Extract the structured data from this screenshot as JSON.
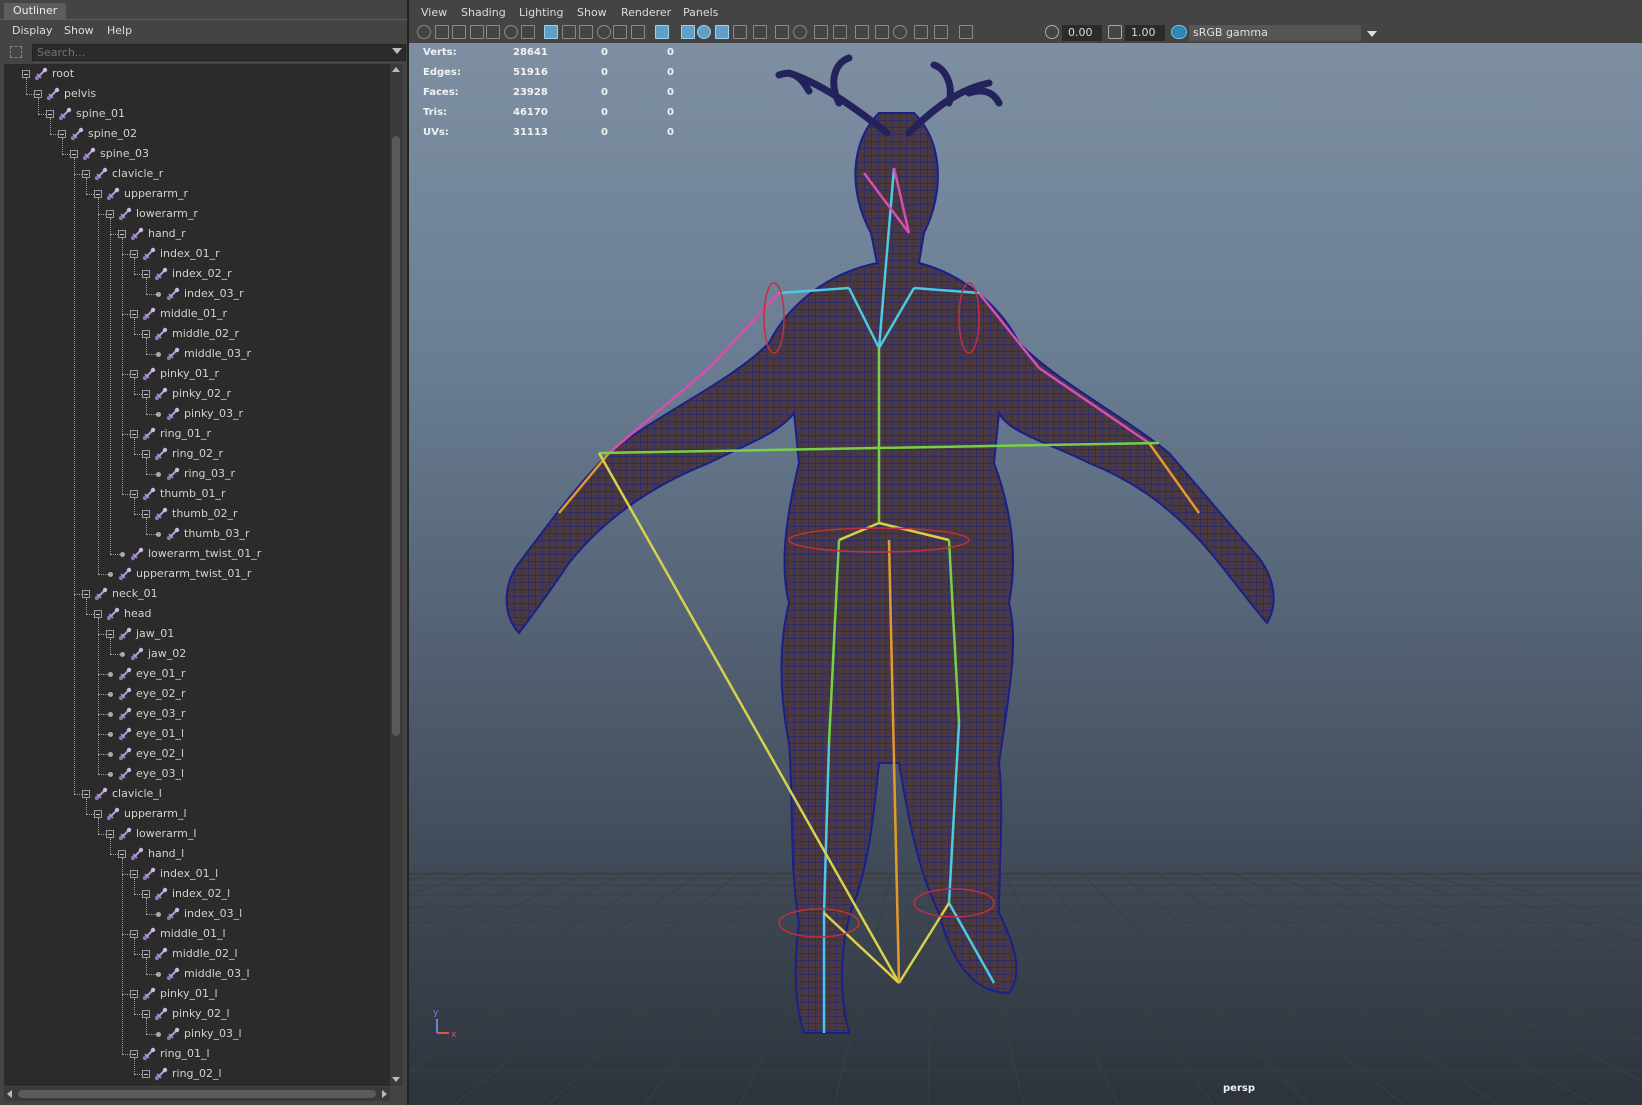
{
  "outliner": {
    "tab_title": "Outliner",
    "menu": [
      "Display",
      "Show",
      "Help"
    ],
    "search_placeholder": "Search...",
    "tree": [
      {
        "label": "root",
        "depth": 0,
        "expanded": true
      },
      {
        "label": "pelvis",
        "depth": 1,
        "expanded": true
      },
      {
        "label": "spine_01",
        "depth": 2,
        "expanded": true
      },
      {
        "label": "spine_02",
        "depth": 3,
        "expanded": true
      },
      {
        "label": "spine_03",
        "depth": 4,
        "expanded": true
      },
      {
        "label": "clavicle_r",
        "depth": 5,
        "expanded": true
      },
      {
        "label": "upperarm_r",
        "depth": 6,
        "expanded": true
      },
      {
        "label": "lowerarm_r",
        "depth": 7,
        "expanded": true
      },
      {
        "label": "hand_r",
        "depth": 8,
        "expanded": true
      },
      {
        "label": "index_01_r",
        "depth": 9,
        "expanded": true
      },
      {
        "label": "index_02_r",
        "depth": 10,
        "expanded": true
      },
      {
        "label": "index_03_r",
        "depth": 11,
        "expanded": false
      },
      {
        "label": "middle_01_r",
        "depth": 9,
        "expanded": true
      },
      {
        "label": "middle_02_r",
        "depth": 10,
        "expanded": true
      },
      {
        "label": "middle_03_r",
        "depth": 11,
        "expanded": false
      },
      {
        "label": "pinky_01_r",
        "depth": 9,
        "expanded": true
      },
      {
        "label": "pinky_02_r",
        "depth": 10,
        "expanded": true
      },
      {
        "label": "pinky_03_r",
        "depth": 11,
        "expanded": false
      },
      {
        "label": "ring_01_r",
        "depth": 9,
        "expanded": true
      },
      {
        "label": "ring_02_r",
        "depth": 10,
        "expanded": true
      },
      {
        "label": "ring_03_r",
        "depth": 11,
        "expanded": false
      },
      {
        "label": "thumb_01_r",
        "depth": 9,
        "expanded": true
      },
      {
        "label": "thumb_02_r",
        "depth": 10,
        "expanded": true
      },
      {
        "label": "thumb_03_r",
        "depth": 11,
        "expanded": false
      },
      {
        "label": "lowerarm_twist_01_r",
        "depth": 8,
        "expanded": false
      },
      {
        "label": "upperarm_twist_01_r",
        "depth": 7,
        "expanded": false
      },
      {
        "label": "neck_01",
        "depth": 5,
        "expanded": true
      },
      {
        "label": "head",
        "depth": 6,
        "expanded": true
      },
      {
        "label": "jaw_01",
        "depth": 7,
        "expanded": true
      },
      {
        "label": "jaw_02",
        "depth": 8,
        "expanded": false
      },
      {
        "label": "eye_01_r",
        "depth": 7,
        "expanded": false
      },
      {
        "label": "eye_02_r",
        "depth": 7,
        "expanded": false
      },
      {
        "label": "eye_03_r",
        "depth": 7,
        "expanded": false
      },
      {
        "label": "eye_01_l",
        "depth": 7,
        "expanded": false
      },
      {
        "label": "eye_02_l",
        "depth": 7,
        "expanded": false
      },
      {
        "label": "eye_03_l",
        "depth": 7,
        "expanded": false
      },
      {
        "label": "clavicle_l",
        "depth": 5,
        "expanded": true
      },
      {
        "label": "upperarm_l",
        "depth": 6,
        "expanded": true
      },
      {
        "label": "lowerarm_l",
        "depth": 7,
        "expanded": true
      },
      {
        "label": "hand_l",
        "depth": 8,
        "expanded": true
      },
      {
        "label": "index_01_l",
        "depth": 9,
        "expanded": true
      },
      {
        "label": "index_02_l",
        "depth": 10,
        "expanded": true
      },
      {
        "label": "index_03_l",
        "depth": 11,
        "expanded": false
      },
      {
        "label": "middle_01_l",
        "depth": 9,
        "expanded": true
      },
      {
        "label": "middle_02_l",
        "depth": 10,
        "expanded": true
      },
      {
        "label": "middle_03_l",
        "depth": 11,
        "expanded": false
      },
      {
        "label": "pinky_01_l",
        "depth": 9,
        "expanded": true
      },
      {
        "label": "pinky_02_l",
        "depth": 10,
        "expanded": true
      },
      {
        "label": "pinky_03_l",
        "depth": 11,
        "expanded": false
      },
      {
        "label": "ring_01_l",
        "depth": 9,
        "expanded": true
      },
      {
        "label": "ring_02_l",
        "depth": 10,
        "expanded": true
      }
    ]
  },
  "viewport": {
    "menu": [
      "View",
      "Shading",
      "Lighting",
      "Show",
      "Renderer",
      "Panels"
    ],
    "exposure_value": "0.00",
    "gamma_value": "1.00",
    "colorspace": "sRGB gamma",
    "camera_label": "persp",
    "hud": [
      {
        "label": "Verts:",
        "values": [
          "28641",
          "0",
          "0"
        ]
      },
      {
        "label": "Edges:",
        "values": [
          "51916",
          "0",
          "0"
        ]
      },
      {
        "label": "Faces:",
        "values": [
          "23928",
          "0",
          "0"
        ]
      },
      {
        "label": "Tris:",
        "values": [
          "46170",
          "0",
          "0"
        ]
      },
      {
        "label": "UVs:",
        "values": [
          "31113",
          "0",
          "0"
        ]
      }
    ],
    "axis_labels": {
      "y": "y",
      "x": "x"
    },
    "colors": {
      "mesh_wire": "#1a1f8a",
      "mesh_body": "#4a3a40",
      "joint_pink": "#d64fb0",
      "joint_cyan": "#4fc8e0",
      "joint_yellow": "#d6d24a",
      "joint_orange": "#e39a2c",
      "joint_green": "#78d04a",
      "ik_red": "#c0303a",
      "grid": "#3a3f46"
    }
  }
}
